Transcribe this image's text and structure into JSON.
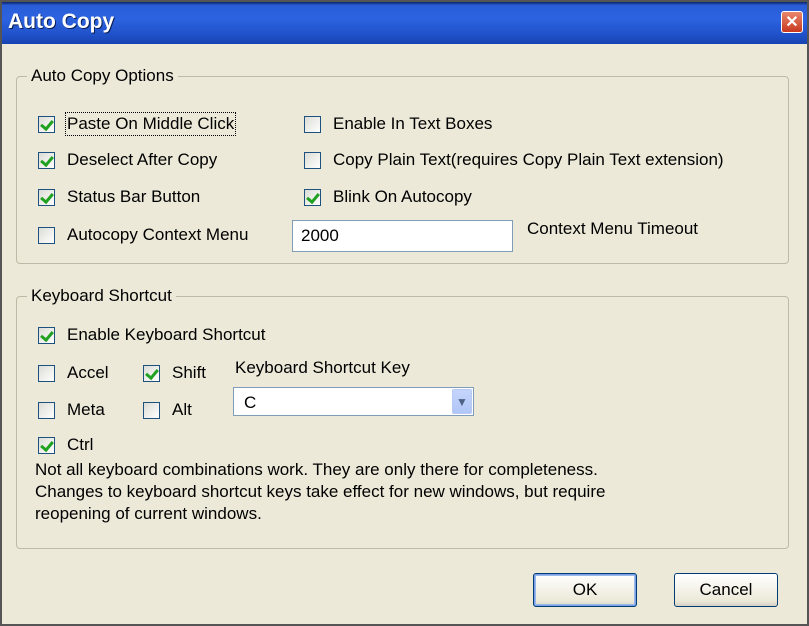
{
  "window": {
    "title": "Auto Copy",
    "close_symbol": "✕"
  },
  "auto_copy_options": {
    "legend": "Auto Copy Options",
    "paste_on_middle_click": {
      "label": "Paste On Middle Click",
      "checked": true
    },
    "deselect_after_copy": {
      "label": "Deselect After Copy",
      "checked": true
    },
    "status_bar_button": {
      "label": "Status Bar Button",
      "checked": true
    },
    "autocopy_context_menu": {
      "label": "Autocopy Context Menu",
      "checked": false
    },
    "enable_in_text_boxes": {
      "label": "Enable In Text Boxes",
      "checked": false
    },
    "copy_plain_text": {
      "label": "Copy Plain Text(requires Copy Plain Text extension)",
      "checked": false
    },
    "blink_on_autocopy": {
      "label": "Blink On Autocopy",
      "checked": true
    },
    "context_menu_timeout_value": "2000",
    "context_menu_timeout_label": "Context Menu Timeout"
  },
  "keyboard_shortcut": {
    "legend": "Keyboard Shortcut",
    "enable": {
      "label": "Enable Keyboard Shortcut",
      "checked": true
    },
    "accel": {
      "label": "Accel",
      "checked": false
    },
    "shift": {
      "label": "Shift",
      "checked": true
    },
    "meta": {
      "label": "Meta",
      "checked": false
    },
    "alt": {
      "label": "Alt",
      "checked": false
    },
    "ctrl": {
      "label": "Ctrl",
      "checked": true
    },
    "key_label": "Keyboard Shortcut Key",
    "key_value": "C",
    "note_line1": "Not all keyboard combinations work. They are only there for completeness.",
    "note_line2": "Changes to keyboard shortcut keys take effect for new windows, but require",
    "note_line3": "reopening of current windows."
  },
  "buttons": {
    "ok": "OK",
    "cancel": "Cancel"
  },
  "colors": {
    "titlebar": "#2c63e0",
    "dialog_bg": "#ece9d8",
    "check": "#21a121"
  }
}
